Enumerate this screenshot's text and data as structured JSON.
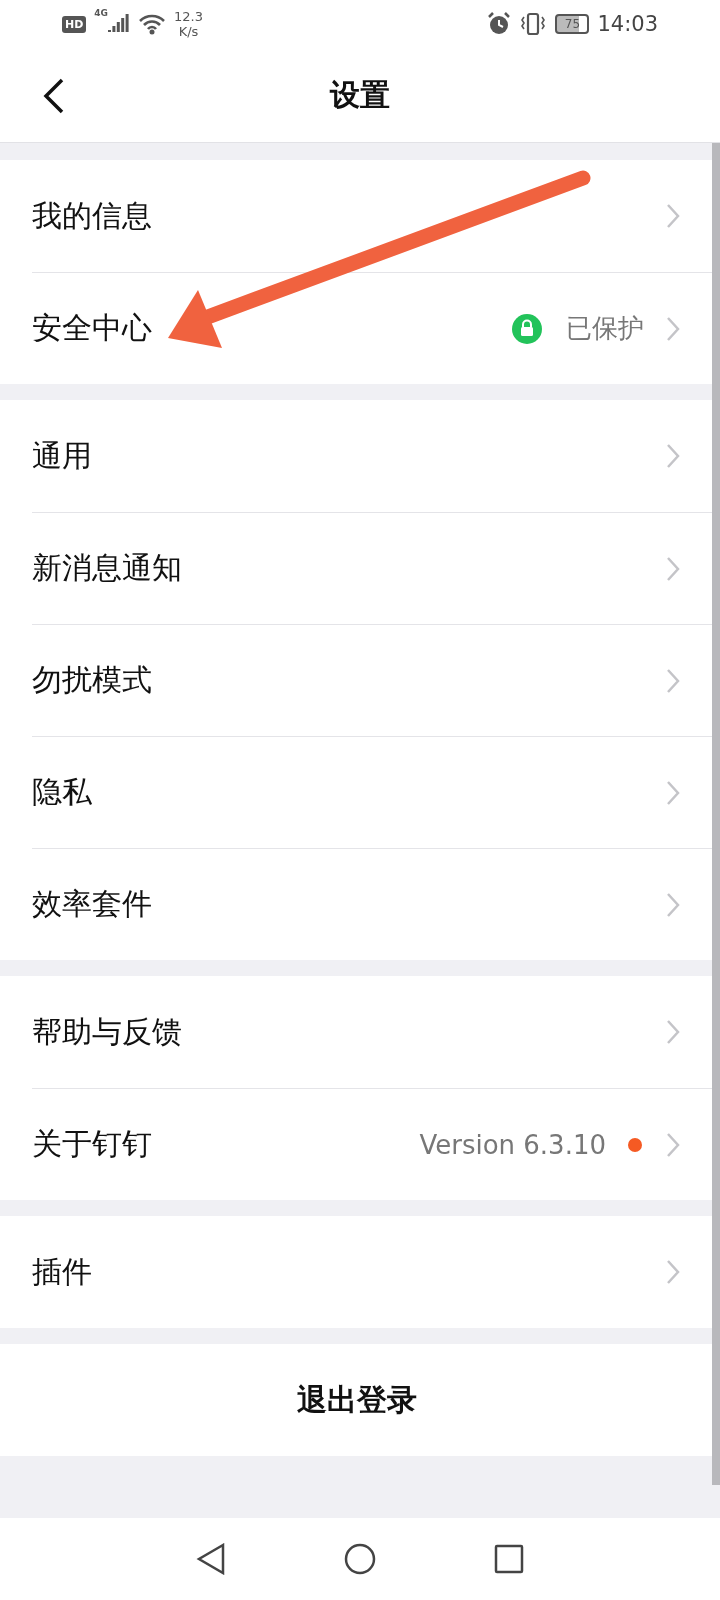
{
  "status_bar": {
    "hd": "HD",
    "network": "4G",
    "speed": "12.3",
    "speed_unit": "K/s",
    "battery": "75",
    "time": "14:03"
  },
  "header": {
    "title": "设置"
  },
  "sections": [
    {
      "items": [
        {
          "kind": "plain",
          "label": "我的信息"
        },
        {
          "kind": "status",
          "label": "安全中心",
          "value": "已保护",
          "color": "#22c35a"
        }
      ]
    },
    {
      "items": [
        {
          "kind": "plain",
          "label": "通用"
        },
        {
          "kind": "plain",
          "label": "新消息通知"
        },
        {
          "kind": "plain",
          "label": "勿扰模式"
        },
        {
          "kind": "plain",
          "label": "隐私"
        },
        {
          "kind": "plain",
          "label": "效率套件"
        }
      ]
    },
    {
      "items": [
        {
          "kind": "plain",
          "label": "帮助与反馈"
        },
        {
          "kind": "version",
          "label": "关于钉钉",
          "value": "Version 6.3.10",
          "color": "#f55a23"
        }
      ]
    },
    {
      "items": [
        {
          "kind": "plain",
          "label": "插件"
        }
      ]
    }
  ],
  "logout": {
    "label": "退出登录"
  },
  "annotation": {
    "kind": "arrow"
  }
}
